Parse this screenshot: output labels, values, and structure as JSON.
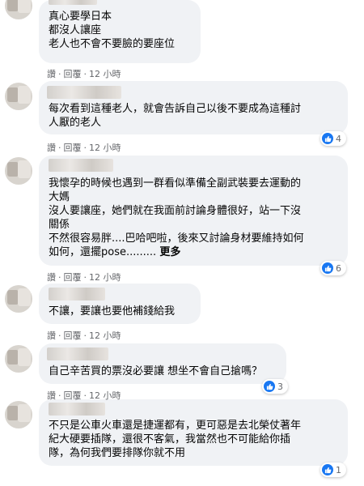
{
  "action_labels": {
    "like": "讚",
    "reply": "回覆",
    "separator": "·",
    "time": "12 小時"
  },
  "comments": [
    {
      "lines": "真心要學日本\n都沒人讓座\n老人也不會不要臉的要座位",
      "likes": null
    },
    {
      "lines": "每次看到這種老人，就會告訴自己以後不要成為這種討\n人厭的老人",
      "likes": "4"
    },
    {
      "lines": "我懷孕的時候也遇到一群看似準備全副武裝要去運動的\n大媽\n沒人要讓座，她們就在我面前討論身體很好，站一下沒\n關係\n不然很容易胖....巴哈吧啦，後來又討論身材要維持如何\n如何，還擺pose.........",
      "more": "更多",
      "likes": "6"
    },
    {
      "lines": "不讓，要讓也要他補錢給我",
      "likes": null
    },
    {
      "lines": "自己辛苦買的票沒必要讓 想坐不會自己搶嗎？",
      "likes": "3"
    },
    {
      "lines": "不只是公車火車還是捷運都有，更可惡是去北榮仗著年\n紀大硬要插隊，還很不客氣，我當然也不可能給你插\n隊，為何我們要排隊你就不用",
      "likes": "1"
    }
  ]
}
